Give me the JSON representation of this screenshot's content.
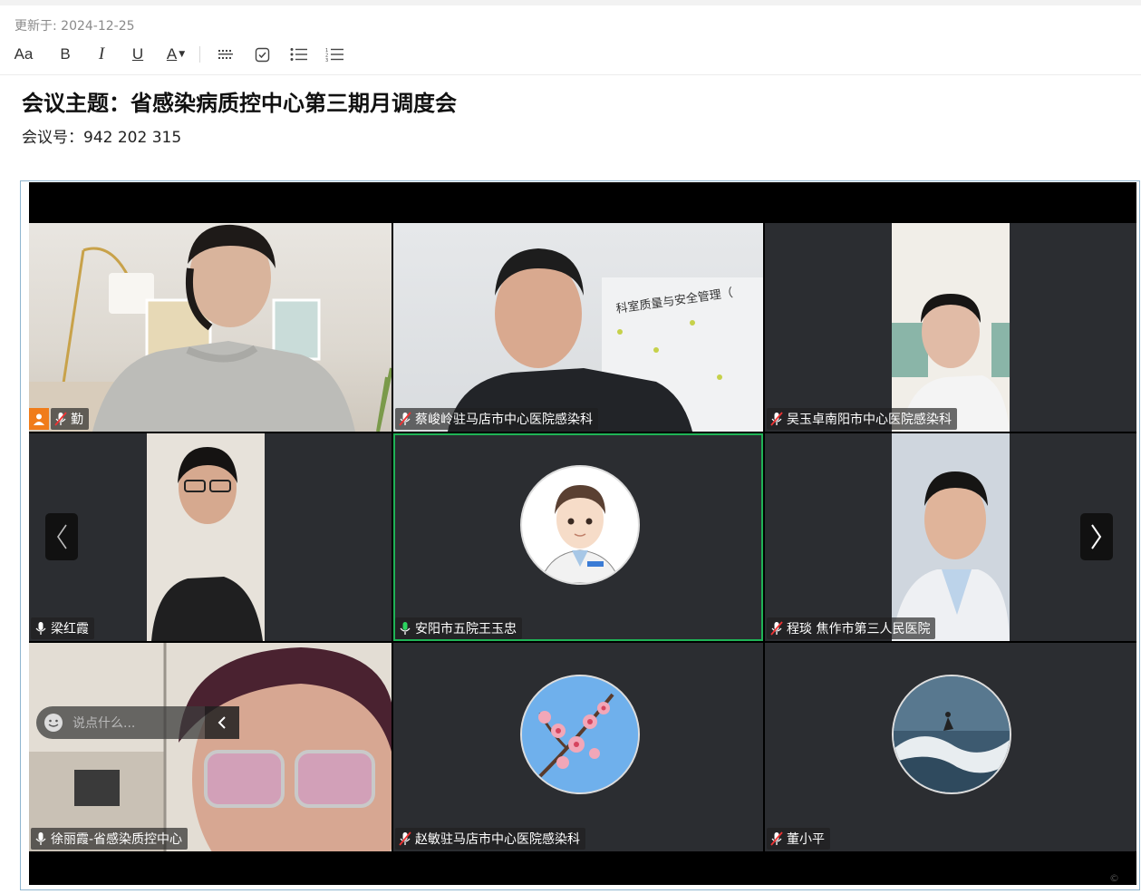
{
  "doc": {
    "updated": "更新于: 2024-12-25",
    "title": "会议主题：省感染病质控中心第三期月调度会",
    "meeting_id": "会议号：942 202 315"
  },
  "toolbar": {
    "items": [
      {
        "name": "text-style",
        "label": "Aa"
      },
      {
        "name": "bold",
        "label": "B"
      },
      {
        "name": "italic",
        "label": "I"
      },
      {
        "name": "underline",
        "label": "U"
      },
      {
        "name": "font-color",
        "label": "A"
      }
    ]
  },
  "meeting": {
    "chat_placeholder": "说点什么...",
    "participants": [
      {
        "name": "勤",
        "mic": "muted",
        "host": true
      },
      {
        "name": "蔡峻岭驻马店市中心医院感染科",
        "mic": "muted"
      },
      {
        "name": "吴玉卓南阳市中心医院感染科",
        "mic": "muted"
      },
      {
        "name": "梁红霞",
        "mic": "on"
      },
      {
        "name": "安阳市五院王玉忠",
        "mic": "active",
        "active": true
      },
      {
        "name": "程琰 焦作市第三人民医院",
        "mic": "muted"
      },
      {
        "name": "徐丽霞-省感染质控中心",
        "mic": "on"
      },
      {
        "name": "赵敏驻马店市中心医院感染科",
        "mic": "muted"
      },
      {
        "name": "董小平",
        "mic": "muted"
      }
    ],
    "office_sign": "科室质量与安全管理（",
    "colors": {
      "active_border": "#1fb356",
      "host_badge": "#f07c1a",
      "tile_bg": "#2b2d31"
    }
  },
  "corner": "©"
}
